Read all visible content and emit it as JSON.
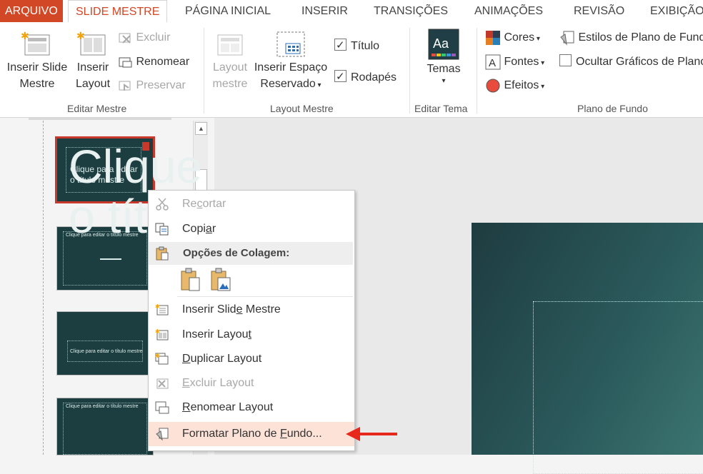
{
  "tabs": {
    "file": "ARQUIVO",
    "active": "SLIDE MESTRE",
    "items": [
      "PÁGINA INICIAL",
      "INSERIR",
      "TRANSIÇÕES",
      "ANIMAÇÕES",
      "REVISÃO",
      "EXIBIÇÃO"
    ]
  },
  "ribbon": {
    "editar_mestre": {
      "label": "Editar Mestre",
      "inserir_slide_mestre": [
        "Inserir Slide",
        "Mestre"
      ],
      "inserir_layout": [
        "Inserir",
        "Layout"
      ],
      "excluir": "Excluir",
      "renomear": "Renomear",
      "preservar": "Preservar"
    },
    "layout_mestre": {
      "label": "Layout Mestre",
      "layout_mestre_btn": [
        "Layout",
        "mestre"
      ],
      "inserir_espaco": [
        "Inserir Espaço",
        "Reservado"
      ],
      "titulo": "Título",
      "rodapes": "Rodapés"
    },
    "editar_tema": {
      "label": "Editar Tema",
      "temas": "Temas"
    },
    "plano_de_fundo": {
      "label": "Plano de Fundo",
      "cores": "Cores",
      "fontes": "Fontes",
      "efeitos": "Efeitos",
      "estilos": "Estilos de Plano de Fundo",
      "ocultar": "Ocultar Gráficos de Plano"
    }
  },
  "thumbnails": {
    "t1": [
      "Clique para editar",
      "o título mestre"
    ],
    "t2": "Clique para editar o título mestre",
    "t3": "Clique para editar o título mestre",
    "t4": "Clique para editar o título mestre"
  },
  "slide": {
    "title_line1": "Clique",
    "title_line2": "o título"
  },
  "context_menu": {
    "recortar": {
      "pre": "Re",
      "u": "c",
      "post": "ortar"
    },
    "copiar": {
      "pre": "Copi",
      "u": "a",
      "post": "r"
    },
    "opcoes_colagem": "Opções de Colagem:",
    "inserir_slide_mestre": {
      "pre": "Inserir Slid",
      "u": "e",
      "post": " Mestre"
    },
    "inserir_layout": {
      "pre": "Inserir Layou",
      "u": "t",
      "post": ""
    },
    "duplicar_layout": {
      "pre": "",
      "u": "D",
      "post": "uplicar Layout"
    },
    "excluir_layout": {
      "pre": "",
      "u": "E",
      "post": "xcluir Layout"
    },
    "renomear_layout": {
      "pre": "",
      "u": "R",
      "post": "enomear Layout"
    },
    "formatar_plano": {
      "pre": "Formatar Plano de ",
      "u": "F",
      "post": "undo..."
    }
  },
  "colors": {
    "accent": "#d24726",
    "arrow": "#e8281d",
    "slide_bg": "#1e3c40"
  }
}
